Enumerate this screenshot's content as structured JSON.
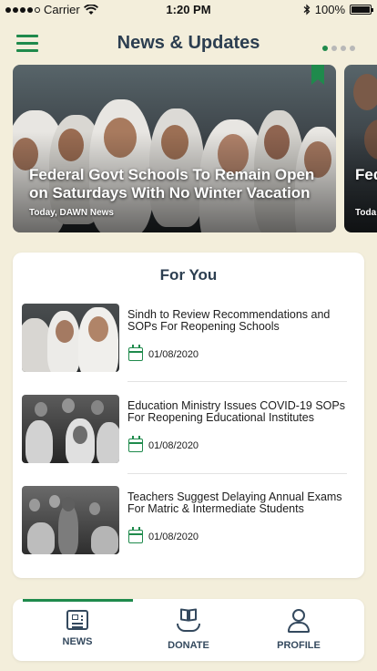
{
  "status_bar": {
    "carrier": "Carrier",
    "time": "1:20 PM",
    "battery": "100%"
  },
  "header": {
    "title": "News & Updates",
    "menu_icon": "hamburger-menu-icon"
  },
  "carousel": {
    "pages": 4,
    "active_page": 1,
    "slides": [
      {
        "title": "Federal Govt Schools To Remain Open on Saturdays With No Winter Vacation",
        "meta": "Today, DAWN News",
        "bookmarked": true
      },
      {
        "title": "Fed on",
        "meta": "Toda"
      }
    ]
  },
  "for_you": {
    "heading": "For You",
    "items": [
      {
        "headline": "Sindh to Review Recommendations and SOPs For Reopening Schools",
        "date": "01/08/2020"
      },
      {
        "headline": "Education Ministry Issues COVID-19 SOPs For Reopening Educational Institutes",
        "date": "01/08/2020"
      },
      {
        "headline": "Teachers Suggest Delaying Annual Exams For Matric & Intermediate Students",
        "date": "01/08/2020"
      }
    ]
  },
  "bottom_nav": {
    "active": "news",
    "tabs": [
      {
        "id": "news",
        "label": "NEWS",
        "icon": "newspaper-icon"
      },
      {
        "id": "donate",
        "label": "DONATE",
        "icon": "book-hand-icon"
      },
      {
        "id": "profile",
        "label": "PROFILE",
        "icon": "person-icon"
      }
    ]
  },
  "colors": {
    "background": "#f3eedb",
    "accent": "#1f8a4c",
    "title_text": "#2c3e50"
  }
}
